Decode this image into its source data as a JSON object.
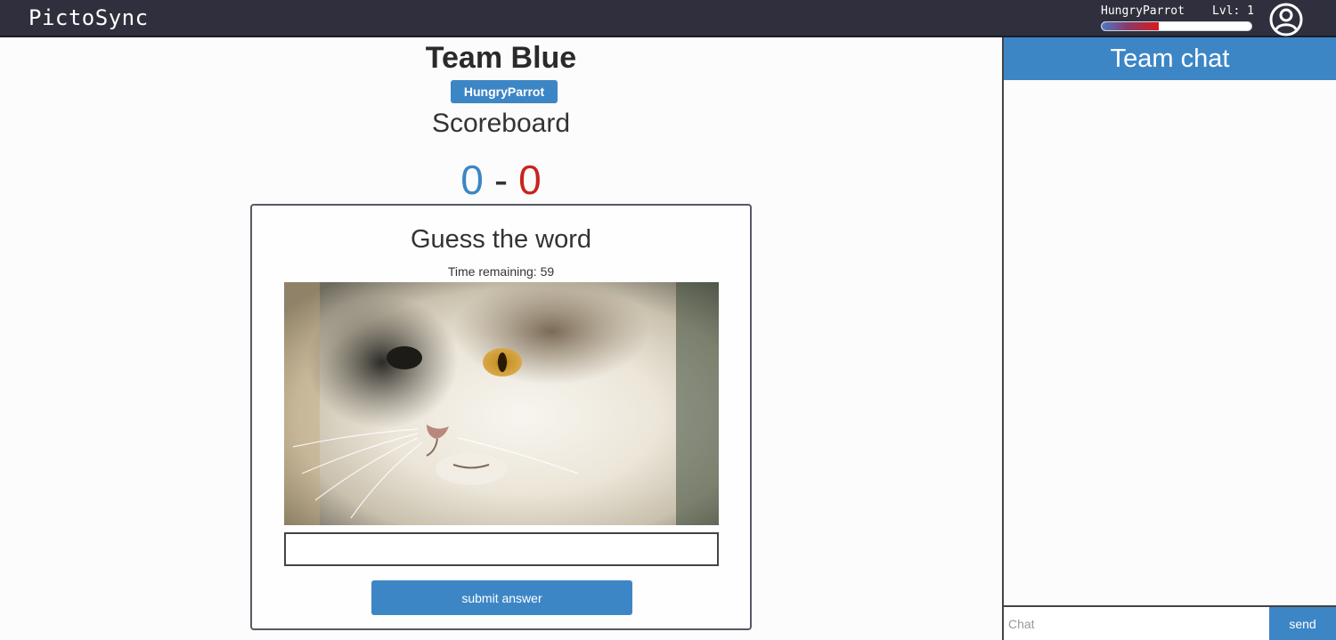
{
  "app": {
    "brand": "PictoSync"
  },
  "user": {
    "name": "HungryParrot",
    "level_text": "Lvl: 1",
    "xp_progress": 0.38
  },
  "game": {
    "team_title": "Team Blue",
    "player_badge": "HungryParrot",
    "scoreboard_title": "Scoreboard",
    "score": {
      "blue": "0",
      "separator": "-",
      "red": "0"
    },
    "card": {
      "title": "Guess the word",
      "timer_label": "Time remaining: 59",
      "image_icon": "cat-photo",
      "answer_value": "",
      "submit_label": "submit answer"
    }
  },
  "chat": {
    "title": "Team chat",
    "messages": [],
    "input_placeholder": "Chat",
    "send_label": "send"
  },
  "colors": {
    "topbar": "#2f2f3d",
    "accent": "#3d86c6",
    "team_blue": "#3d86c6",
    "team_red": "#c9241c"
  }
}
